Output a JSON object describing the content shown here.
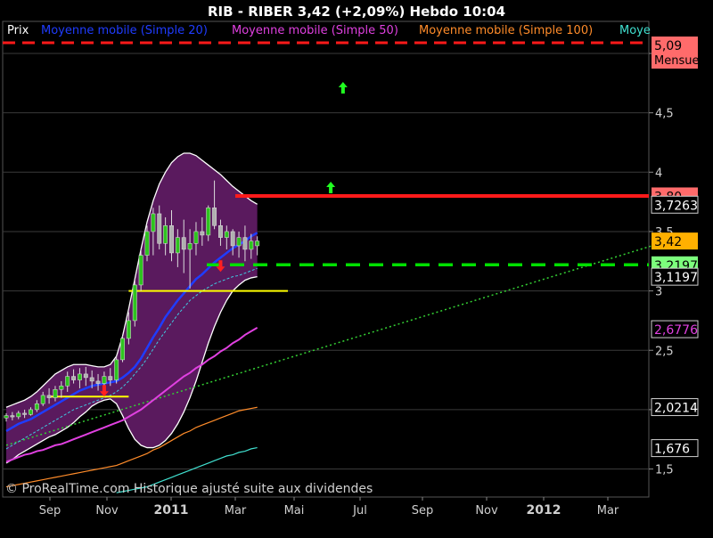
{
  "header": {
    "title": "RIB - RIBER     3,42 (+2,09%)     Hebdo  10:04"
  },
  "legend": [
    {
      "label": "Prix",
      "color": "#ffffff"
    },
    {
      "label": "Moyenne mobile (Simple 20)",
      "color": "#1f3cff"
    },
    {
      "label": "Moyenne mobile (Simple 50)",
      "color": "#e040e0"
    },
    {
      "label": "Moyenne mobile (Simple 100)",
      "color": "#ff8c2a"
    },
    {
      "label": "Moye",
      "color": "#40e0d0"
    }
  ],
  "footer_text": "© ProRealTime.com Historique ajusté suite aux dividendes",
  "colors": {
    "background": "#000000",
    "bollinger_fill": "#5a1a5e",
    "candle_up": "#2ec41f",
    "candle_down": "#b0b0b0",
    "resistance": "#ff1a1a",
    "support": "#00e000",
    "sma20": "#1f3cff",
    "sma50": "#e040e0",
    "sma100": "#ff8c2a",
    "sma200": "#40e0d0",
    "trendline": "#34d034",
    "yellow_line": "#ffff00",
    "monthly_line": "#ff1a1a"
  },
  "chart_data": {
    "type": "candlestick",
    "title": "RIB - RIBER 3,42 (+2,09%) Hebdo 10:04",
    "xlabel": "",
    "ylabel": "",
    "x_ticks": [
      "Sep",
      "Nov",
      "2011",
      "Mar",
      "Mai",
      "Jul",
      "Sep",
      "Nov",
      "2012",
      "Mar"
    ],
    "y_ticks": [
      "1,5",
      "2",
      "2,5",
      "3",
      "3,5",
      "4",
      "4,5",
      "5"
    ],
    "ylim": [
      1.4,
      5.15
    ],
    "right_labels": [
      {
        "text": "5,09",
        "sub": "Mensuel",
        "value": 5.09,
        "bg": "#ff6b6b",
        "fg": "#000000"
      },
      {
        "text": "3,80",
        "value": 3.8,
        "bg": "#ff6b6b",
        "fg": "#000000"
      },
      {
        "text": "3,7263",
        "value": 3.7263,
        "bg": "#000000",
        "fg": "#ffffff"
      },
      {
        "text": "3,42",
        "value": 3.42,
        "bg": "#ffb000",
        "fg": "#000000"
      },
      {
        "text": "3,2197",
        "value": 3.2197,
        "bg": "#7cff7c",
        "fg": "#000000"
      },
      {
        "text": "3,1197",
        "value": 3.1197,
        "bg": "#000000",
        "fg": "#ffffff"
      },
      {
        "text": "2,6776",
        "value": 2.6776,
        "bg": "#000000",
        "fg": "#e040e0"
      },
      {
        "text": "2,0214",
        "value": 2.0214,
        "bg": "#000000",
        "fg": "#ffffff"
      },
      {
        "text": "1,676",
        "value": 1.676,
        "bg": "#000000",
        "fg": "#ffffff"
      }
    ],
    "horizontal_levels": [
      {
        "name": "monthly",
        "value": 5.09,
        "style": "dashed-red"
      },
      {
        "name": "resistance",
        "value": 3.8,
        "style": "solid-red"
      },
      {
        "name": "support",
        "value": 3.22,
        "style": "dashed-green"
      }
    ],
    "series": [
      {
        "name": "Prix",
        "type": "candles",
        "data": [
          {
            "o": 1.93,
            "h": 1.97,
            "l": 1.9,
            "c": 1.95
          },
          {
            "o": 1.95,
            "h": 1.98,
            "l": 1.91,
            "c": 1.94
          },
          {
            "o": 1.94,
            "h": 1.99,
            "l": 1.92,
            "c": 1.97
          },
          {
            "o": 1.97,
            "h": 2.0,
            "l": 1.93,
            "c": 1.96
          },
          {
            "o": 1.96,
            "h": 2.02,
            "l": 1.95,
            "c": 2.0
          },
          {
            "o": 2.0,
            "h": 2.08,
            "l": 1.98,
            "c": 2.05
          },
          {
            "o": 2.05,
            "h": 2.15,
            "l": 2.03,
            "c": 2.12
          },
          {
            "o": 2.12,
            "h": 2.18,
            "l": 2.05,
            "c": 2.1
          },
          {
            "o": 2.1,
            "h": 2.2,
            "l": 2.07,
            "c": 2.17
          },
          {
            "o": 2.17,
            "h": 2.24,
            "l": 2.1,
            "c": 2.2
          },
          {
            "o": 2.2,
            "h": 2.32,
            "l": 2.15,
            "c": 2.28
          },
          {
            "o": 2.28,
            "h": 2.34,
            "l": 2.22,
            "c": 2.25
          },
          {
            "o": 2.25,
            "h": 2.35,
            "l": 2.18,
            "c": 2.3
          },
          {
            "o": 2.3,
            "h": 2.36,
            "l": 2.2,
            "c": 2.27
          },
          {
            "o": 2.27,
            "h": 2.33,
            "l": 2.18,
            "c": 2.24
          },
          {
            "o": 2.24,
            "h": 2.3,
            "l": 2.16,
            "c": 2.22
          },
          {
            "o": 2.22,
            "h": 2.32,
            "l": 2.18,
            "c": 2.28
          },
          {
            "o": 2.28,
            "h": 2.35,
            "l": 2.2,
            "c": 2.25
          },
          {
            "o": 2.25,
            "h": 2.45,
            "l": 2.22,
            "c": 2.42
          },
          {
            "o": 2.42,
            "h": 2.62,
            "l": 2.4,
            "c": 2.6
          },
          {
            "o": 2.6,
            "h": 2.82,
            "l": 2.55,
            "c": 2.75
          },
          {
            "o": 2.75,
            "h": 3.1,
            "l": 2.7,
            "c": 3.05
          },
          {
            "o": 3.05,
            "h": 3.35,
            "l": 3.0,
            "c": 3.3
          },
          {
            "o": 3.3,
            "h": 3.55,
            "l": 3.25,
            "c": 3.5
          },
          {
            "o": 3.5,
            "h": 3.7,
            "l": 3.3,
            "c": 3.65
          },
          {
            "o": 3.65,
            "h": 3.72,
            "l": 3.35,
            "c": 3.4
          },
          {
            "o": 3.4,
            "h": 3.62,
            "l": 3.3,
            "c": 3.55
          },
          {
            "o": 3.55,
            "h": 3.68,
            "l": 3.25,
            "c": 3.32
          },
          {
            "o": 3.32,
            "h": 3.52,
            "l": 3.2,
            "c": 3.45
          },
          {
            "o": 3.45,
            "h": 3.6,
            "l": 3.15,
            "c": 3.35
          },
          {
            "o": 3.35,
            "h": 3.52,
            "l": 3.02,
            "c": 3.4
          },
          {
            "o": 3.4,
            "h": 3.58,
            "l": 3.3,
            "c": 3.5
          },
          {
            "o": 3.5,
            "h": 3.62,
            "l": 3.38,
            "c": 3.47
          },
          {
            "o": 3.47,
            "h": 3.72,
            "l": 3.42,
            "c": 3.7
          },
          {
            "o": 3.7,
            "h": 3.93,
            "l": 3.52,
            "c": 3.55
          },
          {
            "o": 3.55,
            "h": 3.6,
            "l": 3.38,
            "c": 3.45
          },
          {
            "o": 3.45,
            "h": 3.55,
            "l": 3.35,
            "c": 3.5
          },
          {
            "o": 3.5,
            "h": 3.52,
            "l": 3.3,
            "c": 3.38
          },
          {
            "o": 3.38,
            "h": 3.5,
            "l": 3.28,
            "c": 3.45
          },
          {
            "o": 3.45,
            "h": 3.55,
            "l": 3.25,
            "c": 3.35
          },
          {
            "o": 3.35,
            "h": 3.48,
            "l": 3.27,
            "c": 3.42
          },
          {
            "o": 3.38,
            "h": 3.46,
            "l": 3.3,
            "c": 3.42
          }
        ]
      },
      {
        "name": "Moyenne mobile (Simple 20)",
        "type": "line",
        "values": [
          1.82,
          1.85,
          1.88,
          1.9,
          1.92,
          1.95,
          1.98,
          2.01,
          2.04,
          2.07,
          2.1,
          2.13,
          2.16,
          2.18,
          2.2,
          2.21,
          2.22,
          2.23,
          2.24,
          2.27,
          2.31,
          2.36,
          2.43,
          2.52,
          2.61,
          2.69,
          2.78,
          2.85,
          2.92,
          2.98,
          3.04,
          3.1,
          3.14,
          3.19,
          3.24,
          3.28,
          3.32,
          3.36,
          3.39,
          3.42,
          3.46,
          3.49
        ]
      },
      {
        "name": "Moyenne mobile (Simple 50)",
        "type": "line",
        "values": [
          1.56,
          1.58,
          1.6,
          1.62,
          1.63,
          1.65,
          1.66,
          1.68,
          1.7,
          1.71,
          1.73,
          1.75,
          1.77,
          1.79,
          1.81,
          1.83,
          1.85,
          1.87,
          1.89,
          1.91,
          1.94,
          1.97,
          2.0,
          2.04,
          2.08,
          2.12,
          2.16,
          2.2,
          2.24,
          2.28,
          2.31,
          2.35,
          2.38,
          2.42,
          2.45,
          2.49,
          2.52,
          2.56,
          2.59,
          2.63,
          2.66,
          2.69
        ]
      },
      {
        "name": "Moyenne mobile (Simple 100)",
        "type": "line",
        "values": [
          1.35,
          1.36,
          1.37,
          1.38,
          1.39,
          1.4,
          1.41,
          1.42,
          1.43,
          1.44,
          1.45,
          1.46,
          1.47,
          1.48,
          1.49,
          1.5,
          1.51,
          1.52,
          1.53,
          1.55,
          1.57,
          1.59,
          1.61,
          1.63,
          1.66,
          1.68,
          1.71,
          1.74,
          1.77,
          1.8,
          1.82,
          1.85,
          1.87,
          1.89,
          1.91,
          1.93,
          1.95,
          1.97,
          1.99,
          2.0,
          2.01,
          2.02
        ]
      },
      {
        "name": "Moye",
        "type": "line",
        "values": [
          null,
          null,
          null,
          null,
          null,
          null,
          null,
          null,
          null,
          null,
          null,
          null,
          null,
          null,
          null,
          null,
          null,
          null,
          1.3,
          1.31,
          1.32,
          1.33,
          1.34,
          1.35,
          1.37,
          1.39,
          1.41,
          1.43,
          1.45,
          1.47,
          1.49,
          1.51,
          1.53,
          1.55,
          1.57,
          1.59,
          1.61,
          1.62,
          1.64,
          1.65,
          1.67,
          1.68
        ]
      },
      {
        "name": "bollinger-upper",
        "type": "line",
        "values": [
          2.02,
          2.04,
          2.06,
          2.08,
          2.11,
          2.15,
          2.2,
          2.25,
          2.3,
          2.33,
          2.36,
          2.38,
          2.38,
          2.38,
          2.37,
          2.36,
          2.36,
          2.38,
          2.45,
          2.62,
          2.85,
          3.1,
          3.35,
          3.58,
          3.76,
          3.9,
          4.0,
          4.08,
          4.13,
          4.16,
          4.16,
          4.14,
          4.1,
          4.06,
          4.02,
          3.98,
          3.93,
          3.88,
          3.84,
          3.8,
          3.76,
          3.73
        ]
      },
      {
        "name": "bollinger-lower",
        "type": "line",
        "values": [
          1.55,
          1.58,
          1.62,
          1.65,
          1.68,
          1.71,
          1.74,
          1.77,
          1.79,
          1.82,
          1.85,
          1.89,
          1.94,
          1.98,
          2.03,
          2.06,
          2.08,
          2.09,
          2.05,
          1.95,
          1.84,
          1.75,
          1.7,
          1.68,
          1.68,
          1.7,
          1.74,
          1.8,
          1.88,
          1.98,
          2.1,
          2.24,
          2.4,
          2.56,
          2.7,
          2.82,
          2.92,
          3.0,
          3.05,
          3.09,
          3.11,
          3.12
        ]
      },
      {
        "name": "sma-dotted",
        "type": "line",
        "values": [
          1.67,
          1.7,
          1.73,
          1.76,
          1.79,
          1.82,
          1.85,
          1.88,
          1.91,
          1.94,
          1.97,
          2.0,
          2.02,
          2.04,
          2.06,
          2.08,
          2.1,
          2.12,
          2.15,
          2.19,
          2.24,
          2.3,
          2.36,
          2.43,
          2.51,
          2.59,
          2.66,
          2.73,
          2.8,
          2.86,
          2.92,
          2.96,
          3.0,
          3.03,
          3.06,
          3.08,
          3.1,
          3.12,
          3.13,
          3.15,
          3.17,
          3.19
        ]
      }
    ],
    "trendline": {
      "from": {
        "i": 0,
        "v": 1.7
      },
      "to": {
        "i": 98,
        "v": 3.43
      }
    },
    "yellow_lines": [
      {
        "i0": 7,
        "i1": 20,
        "value": 2.11
      },
      {
        "i0": 20,
        "i1": 46,
        "value": 3.0
      }
    ],
    "signals": [
      {
        "type": "down-arrow",
        "i": 16,
        "value": 2.17,
        "color": "#ff2020"
      },
      {
        "type": "down-arrow",
        "i": 35,
        "value": 3.22,
        "color": "#ff2020"
      },
      {
        "type": "up-arrow",
        "i": 53,
        "value": 3.86,
        "color": "#20ff20"
      },
      {
        "type": "up-arrow",
        "i": 55,
        "value": 4.7,
        "color": "#20ff20"
      }
    ]
  }
}
